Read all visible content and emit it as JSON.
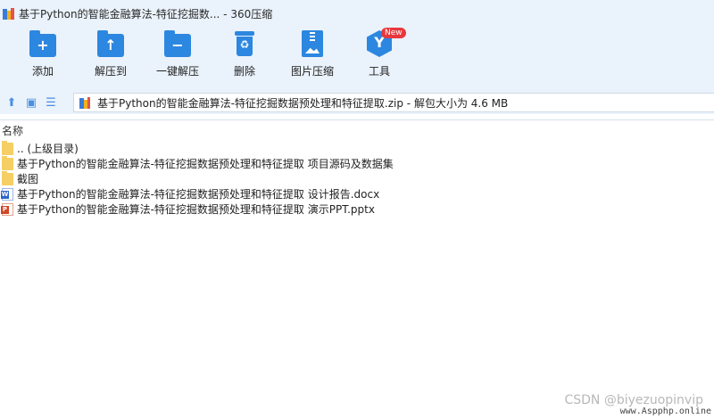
{
  "window": {
    "title": "基于Python的智能金融算法-特征挖掘数... - 360压缩"
  },
  "toolbar": {
    "items": [
      {
        "label": "添加",
        "icon": "add-icon"
      },
      {
        "label": "解压到",
        "icon": "extract-to-icon"
      },
      {
        "label": "一键解压",
        "icon": "one-click-extract-icon"
      },
      {
        "label": "删除",
        "icon": "delete-icon"
      },
      {
        "label": "图片压缩",
        "icon": "image-compress-icon"
      },
      {
        "label": "工具",
        "icon": "tools-icon"
      }
    ],
    "new_badge": "New"
  },
  "address": {
    "path": "基于Python的智能金融算法-特征挖掘数据预处理和特征提取.zip - 解包大小为 4.6 MB"
  },
  "list": {
    "header": "名称",
    "rows": [
      {
        "name": ".. (上级目录)",
        "type": "folder"
      },
      {
        "name": "基于Python的智能金融算法-特征挖掘数据预处理和特征提取 项目源码及数据集",
        "type": "folder"
      },
      {
        "name": "截图",
        "type": "folder"
      },
      {
        "name": "基于Python的智能金融算法-特征挖掘数据预处理和特征提取 设计报告.docx",
        "type": "docx"
      },
      {
        "name": "基于Python的智能金融算法-特征挖掘数据预处理和特征提取 演示PPT.pptx",
        "type": "pptx"
      }
    ]
  },
  "watermark": "CSDN @biyezuopinvip",
  "site": "www.Aspphp.online"
}
